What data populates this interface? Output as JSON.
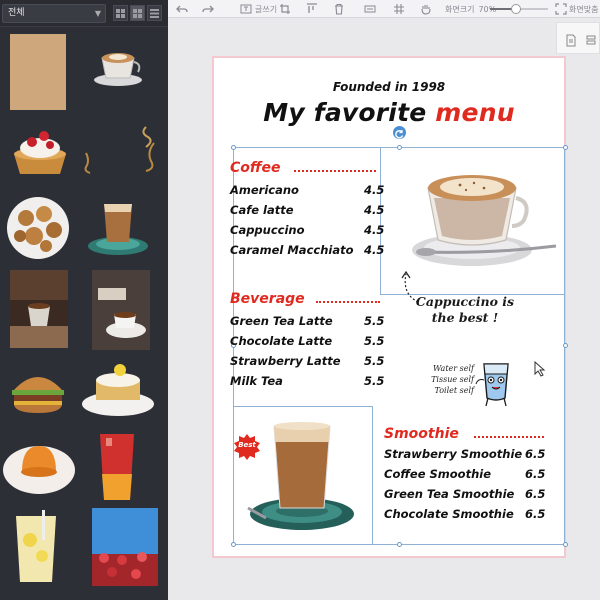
{
  "panel": {
    "filter_label": "전체",
    "view_modes": [
      "grid-small",
      "grid-large",
      "list"
    ]
  },
  "toolbar": {
    "text_label": "글쓰기",
    "zoom_label": "화면크기",
    "zoom_value": "70%",
    "zoom_fraction": 0.45,
    "fit_label": "화면맞춤"
  },
  "menu": {
    "founded": "Founded in 1998",
    "title_main": "My favorite ",
    "title_accent": "menu",
    "sections": {
      "coffee": {
        "title": "Coffee",
        "items": [
          {
            "name": "Americano",
            "price": "4.5"
          },
          {
            "name": "Cafe latte",
            "price": "4.5"
          },
          {
            "name": "Cappuccino",
            "price": "4.5"
          },
          {
            "name": "Caramel Macchiato",
            "price": "4.5"
          }
        ]
      },
      "beverage": {
        "title": "Beverage",
        "items": [
          {
            "name": "Green Tea Latte",
            "price": "5.5"
          },
          {
            "name": "Chocolate Latte",
            "price": "5.5"
          },
          {
            "name": "Strawberry Latte",
            "price": "5.5"
          },
          {
            "name": "Milk Tea",
            "price": "5.5"
          }
        ]
      },
      "smoothie": {
        "title": "Smoothie",
        "items": [
          {
            "name": "Strawberry Smoothie",
            "price": "6.5"
          },
          {
            "name": "Coffee Smoothie",
            "price": "6.5"
          },
          {
            "name": "Green Tea Smoothie",
            "price": "6.5"
          },
          {
            "name": "Chocolate Smoothie",
            "price": "6.5"
          }
        ]
      }
    },
    "callout_line1": "Cappuccino is",
    "callout_line2": "the best !",
    "notes": [
      "Water self",
      "Tissue self",
      "Toilet self"
    ],
    "badge": "Best"
  },
  "colors": {
    "accent": "#e02a1f",
    "panel_bg": "#2d2f36",
    "selection": "#8fb1d6"
  }
}
